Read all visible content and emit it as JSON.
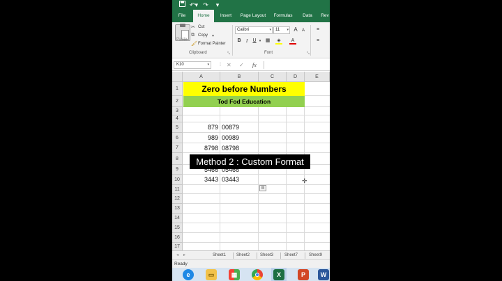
{
  "quick_access": {
    "save_icon": "save-icon",
    "undo_icon": "undo-icon",
    "customize_icon": "customize-icon"
  },
  "ribbon_tabs": [
    "File",
    "Home",
    "Insert",
    "Page Layout",
    "Formulas",
    "Data",
    "Rev"
  ],
  "active_tab": "Home",
  "clipboard": {
    "paste_label": "Paste",
    "cut_label": "Cut",
    "copy_label": "Copy",
    "format_painter_label": "Format Painter",
    "group_label": "Clipboard"
  },
  "font": {
    "name": "Calibri",
    "size": "11",
    "group_label": "Font",
    "bold": "B",
    "italic": "I",
    "underline": "U",
    "grow": "A",
    "shrink": "A"
  },
  "formula_bar": {
    "name_box": "K10",
    "cancel": "✕",
    "enter": "✓",
    "fx": "fx",
    "value": ""
  },
  "columns": [
    "A",
    "B",
    "C",
    "D",
    "E"
  ],
  "rows": [
    "1",
    "2",
    "3",
    "4",
    "5",
    "6",
    "7",
    "8",
    "9",
    "10",
    "11",
    "12",
    "13",
    "14",
    "15",
    "16",
    "17",
    "18"
  ],
  "banner": {
    "title": "Zero before Numbers",
    "subtitle": "Tod Fod Education"
  },
  "data_rows": [
    {
      "row": "5",
      "a": "879",
      "b": "00879"
    },
    {
      "row": "6",
      "a": "989",
      "b": "00989"
    },
    {
      "row": "7",
      "a": "8798",
      "b": "08798"
    },
    {
      "row": "9",
      "a": "5466",
      "b": "05466"
    },
    {
      "row": "10",
      "a": "3443",
      "b": "03443"
    }
  ],
  "sheet_tabs": [
    "Sheet1",
    "Sheet2",
    "Sheet3",
    "Sheet7",
    "Sheet9"
  ],
  "status": "Ready",
  "caption": "Method 2 : Custom Format",
  "taskbar_icons": [
    "internet-explorer-icon",
    "file-explorer-icon",
    "store-icon",
    "chrome-icon",
    "excel-icon",
    "powerpoint-icon",
    "word-icon"
  ],
  "colors": {
    "excel_green": "#217346",
    "banner_yellow": "#ffff00",
    "banner_green": "#92d050"
  }
}
